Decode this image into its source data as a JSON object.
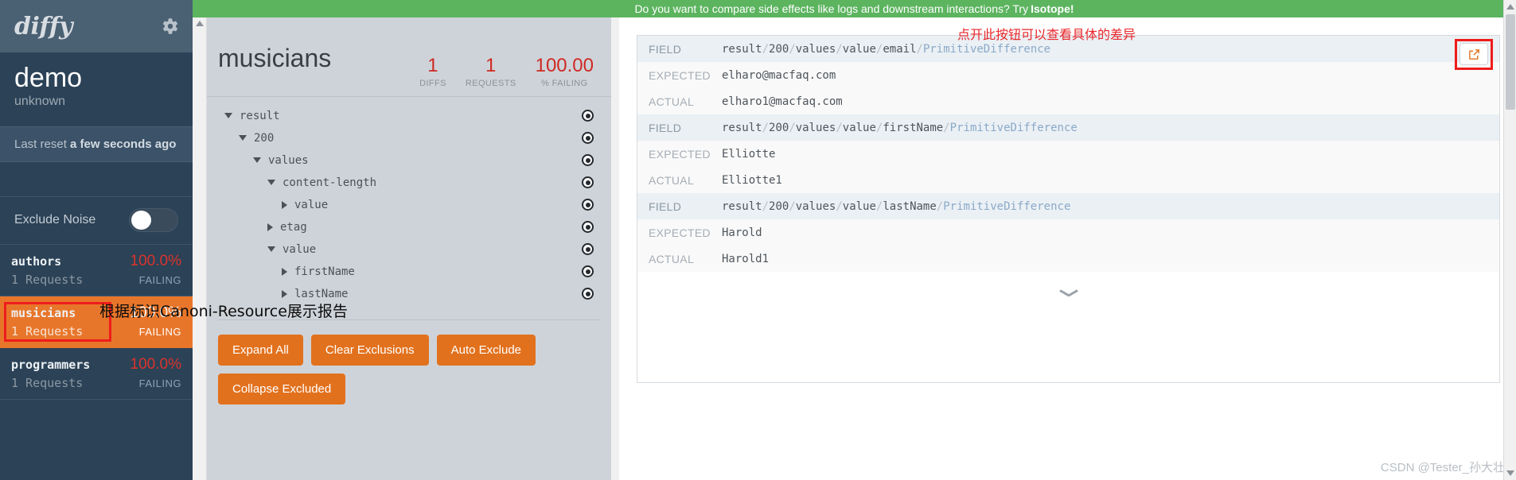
{
  "sidebar": {
    "logo_text": "diffy",
    "gear_icon": "gear-icon",
    "project_name": "demo",
    "project_sub": "unknown",
    "last_reset_prefix": "Last reset ",
    "last_reset_value": "a few seconds ago",
    "exclude_noise_label": "Exclude Noise",
    "exclude_noise_state": "off",
    "services": [
      {
        "name": "authors",
        "requests": "1 Requests",
        "pct": "100.0%",
        "status": "FAILING",
        "active": false
      },
      {
        "name": "musicians",
        "requests": "1 Requests",
        "pct": "100.0%",
        "status": "FAILING",
        "active": true
      },
      {
        "name": "programmers",
        "requests": "1 Requests",
        "pct": "100.0%",
        "status": "FAILING",
        "active": false
      }
    ]
  },
  "promo": {
    "text": "Do you want to compare side effects like logs and downstream interactions? Try ",
    "link": "Isotope!"
  },
  "header": {
    "title": "musicians",
    "stats": [
      {
        "value": "1",
        "label": "DIFFS"
      },
      {
        "value": "1",
        "label": "REQUESTS"
      },
      {
        "value": "100.00",
        "label": "% FAILING"
      }
    ]
  },
  "tree": {
    "nodes": [
      {
        "label": "result",
        "depth": 0,
        "state": "open"
      },
      {
        "label": "200",
        "depth": 1,
        "state": "open"
      },
      {
        "label": "values",
        "depth": 2,
        "state": "open"
      },
      {
        "label": "content-length",
        "depth": 3,
        "state": "open"
      },
      {
        "label": "value",
        "depth": 4,
        "state": "closed"
      },
      {
        "label": "etag",
        "depth": 3,
        "state": "closed"
      },
      {
        "label": "value",
        "depth": 3,
        "state": "open"
      },
      {
        "label": "firstName",
        "depth": 4,
        "state": "closed"
      },
      {
        "label": "lastName",
        "depth": 4,
        "state": "closed"
      }
    ],
    "eye_icon": "eye-target-icon",
    "buttons": [
      "Expand All",
      "Clear Exclusions",
      "Auto Exclude",
      "Collapse Excluded"
    ]
  },
  "diff": {
    "external_link_icon": "external-link-icon",
    "expand_chevron_icon": "chevron-down-icon",
    "rows": [
      {
        "key": "FIELD",
        "type": "field",
        "path_head": "result/200/values/value/email/",
        "path_tail": "PrimitiveDifference"
      },
      {
        "key": "EXPECTED",
        "type": "plain",
        "value": "elharo@macfaq.com"
      },
      {
        "key": "ACTUAL",
        "type": "plain",
        "value": "elharo1@macfaq.com"
      },
      {
        "key": "FIELD",
        "type": "field",
        "path_head": "result/200/values/value/firstName/",
        "path_tail": "PrimitiveDifference"
      },
      {
        "key": "EXPECTED",
        "type": "plain",
        "value": "Elliotte"
      },
      {
        "key": "ACTUAL",
        "type": "plain",
        "value": "Elliotte1"
      },
      {
        "key": "FIELD",
        "type": "field",
        "path_head": "result/200/values/value/lastName/",
        "path_tail": "PrimitiveDifference"
      },
      {
        "key": "EXPECTED",
        "type": "plain",
        "value": "Harold"
      },
      {
        "key": "ACTUAL",
        "type": "plain",
        "value": "Harold1"
      }
    ]
  },
  "annotations": {
    "top_right": "点开此按钮可以查看具体的差异",
    "middle": "根据标识Canoni-Resource展示报告"
  },
  "watermark": "CSDN @Tester_孙大壮",
  "colors": {
    "accent_orange": "#e2711d",
    "sidebar_dark": "#2b4257",
    "promo_green": "#5cb45f",
    "fail_red": "#cf2a23",
    "annotation_red": "#e8272b"
  }
}
